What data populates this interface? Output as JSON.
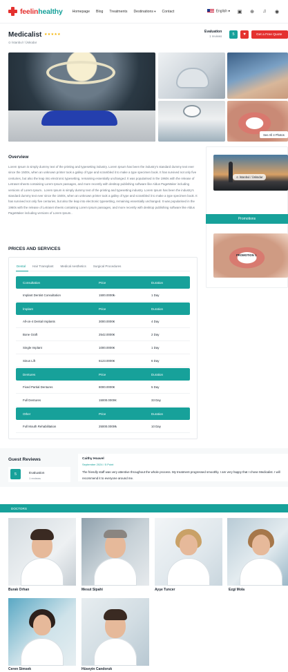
{
  "header": {
    "logo_part1": "feelin",
    "logo_part2": "healthy",
    "nav": [
      "Homepage",
      "Blog",
      "Treatments",
      "Destinations",
      "Contact"
    ],
    "language": "English"
  },
  "clinic": {
    "name": "Medicalist",
    "rating_stars": "★★★★★",
    "location": "İstanbul / Üsküdar",
    "evaluation_label": "Evaluation",
    "evaluation_reviews": "1 reviews",
    "evaluation_score": "5",
    "quote_button": "Get a Free Quote",
    "see_all_photos": "See All 4 Photos"
  },
  "overview": {
    "title": "Overview",
    "text": "Lorem Ipsum is simply dummy text of the printing and typesetting industry. Lorem Ipsum has been the industry's standard dummy text ever since the 1500s, when an unknown printer took a galley of type and scrambled it to make a type specimen book. It has survived not only five centuries, but also the leap into electronic typesetting, remaining essentially unchanged. It was popularised in the 1960s with the release of Letraset sheets containing Lorem Ipsum passages, and more recently with desktop publishing software like Aldus PageMaker including versions of Lorem Ipsum.. Lorem Ipsum is simply dummy text of the printing and typesetting industry. Lorem Ipsum has been the industry's standard dummy text ever since the 1500s, when an unknown printer took a galley of type and scrambled it to make a type specimen book. It has survived not only five centuries, but also the leap into electronic typesetting, remaining essentially unchanged. It was popularised in the 1960s with the release of Letraset sheets containing Lorem Ipsum passages, and more recently with desktop publishing software like Aldus PageMaker including versions of Lorem Ipsum.."
  },
  "sidebar": {
    "city_label": "İstanbul / Üsküdar",
    "promotions_title": "Promotions",
    "promotion_label": "PROMOTION 1"
  },
  "prices": {
    "title": "PRICES AND SERVICES",
    "tabs": [
      "Dental",
      "Hair Transplant",
      "Medical Aesthetics",
      "Surgical Procedures"
    ],
    "groups": [
      {
        "name": "Consultation",
        "price_header": "Price",
        "duration_header": "Duration",
        "rows": [
          {
            "service": "Implant Dentist Consultation",
            "price": "1500.0000₺",
            "duration": "1 Day"
          }
        ]
      },
      {
        "name": "İmplant",
        "price_header": "Price",
        "duration_header": "Duration",
        "rows": [
          {
            "service": "All-on-4 Dental Implants",
            "price": "3000.0000€",
            "duration": "4 Day"
          },
          {
            "service": "Bone Graft",
            "price": "2542.0000€",
            "duration": "2 Day"
          },
          {
            "service": "Single Implant",
            "price": "1000.0000€",
            "duration": "1 Day"
          },
          {
            "service": "Sinus Lift",
            "price": "6123.0000€",
            "duration": "6 Day"
          }
        ]
      },
      {
        "name": "Dentures",
        "price_header": "Price",
        "duration_header": "Duration",
        "rows": [
          {
            "service": "Fixed Partial Dentures",
            "price": "8000.0000€",
            "duration": "5 Day"
          },
          {
            "service": "Full Dentures",
            "price": "15000.0000€",
            "duration": "33 Day"
          }
        ]
      },
      {
        "name": "Other",
        "price_header": "Price",
        "duration_header": "Duration",
        "rows": [
          {
            "service": "Full Mouth Rehabilitation",
            "price": "25000.0000₺",
            "duration": "10 Day"
          }
        ]
      }
    ]
  },
  "reviews": {
    "title": "Guest Reviews",
    "score": "5",
    "evaluation_label": "Evaluation",
    "count": "1 reviews",
    "items": [
      {
        "name": "Caithy Hoavel",
        "meta": "September 2024 / 5 Point",
        "text": "The friendly staff was very attentive throughout the whole process. My treatment progressed smoothly. I am very happy that I chose Medicalist. I will recommend it to everyone around me."
      }
    ]
  },
  "doctors": {
    "title": "DOCTORS",
    "items": [
      "Burak Orhan",
      "Mesut Sipahi",
      "Ayşe Tuncer",
      "Ezgi Mola",
      "Ceren Simsek",
      "Hüseyin Candoruk"
    ]
  }
}
